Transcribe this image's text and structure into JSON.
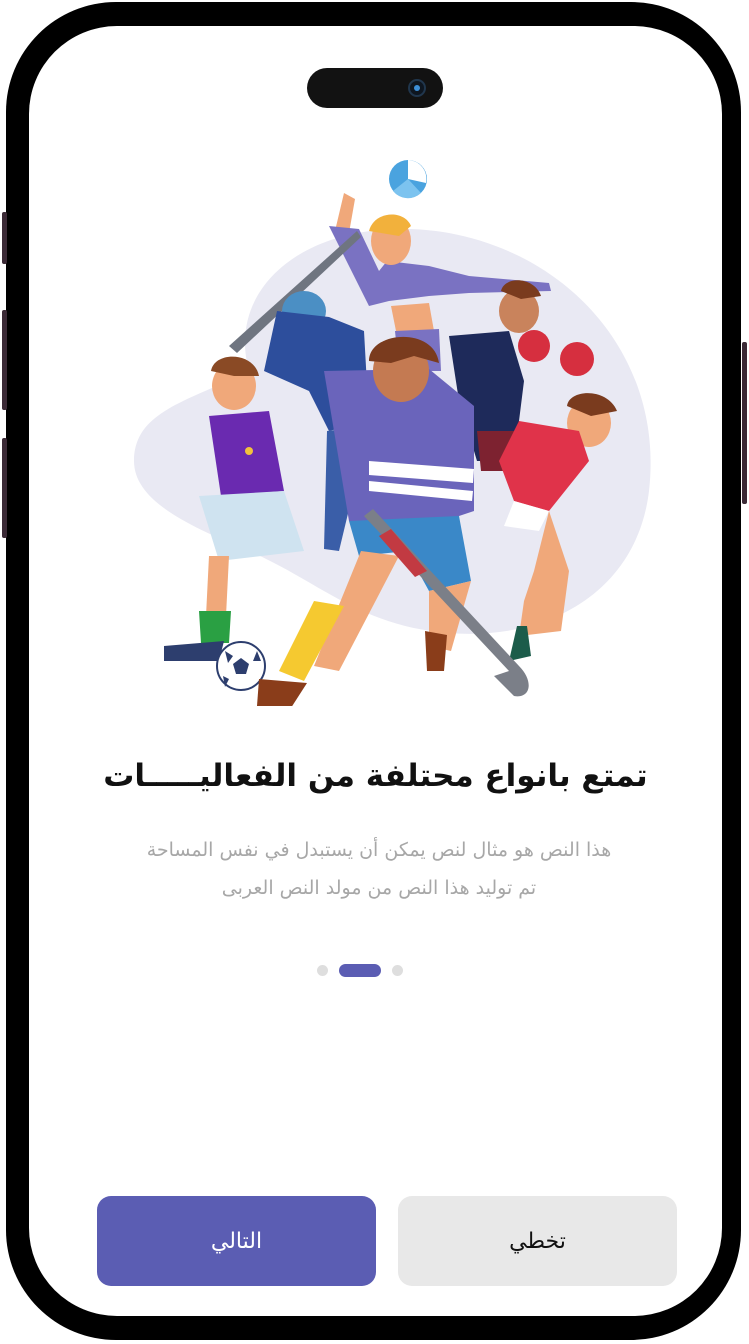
{
  "onboarding": {
    "title": "تمتع بانواع محتلفة من الفعاليـــــات",
    "description_line1": "هذا النص هو مثال لنص يمكن أن يستبدل في نفس المساحة",
    "description_line2": "تم توليد هذا النص من مولد النص العربى",
    "pagination": {
      "total": 3,
      "active_index": 1
    },
    "illustration": "sports-players-illustration"
  },
  "buttons": {
    "next_label": "التالي",
    "skip_label": "تخطي"
  },
  "colors": {
    "primary": "#5b5db3",
    "secondary_button": "#e8e8e8",
    "title": "#111111",
    "description": "#a7a7a7",
    "blob": "#e9e9f3",
    "frame": "#000000"
  }
}
